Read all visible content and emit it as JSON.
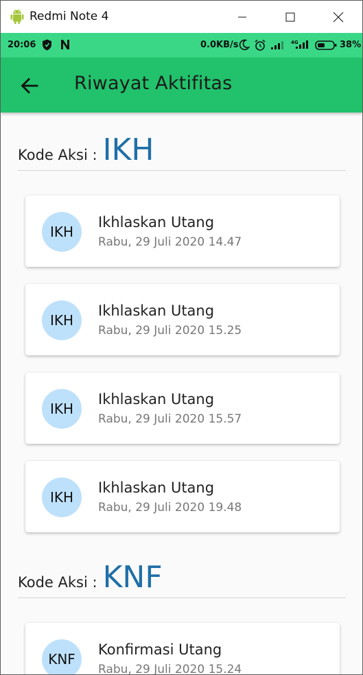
{
  "window": {
    "title": "Redmi Note 4",
    "icon": "android-icon",
    "buttons": [
      "minimize-icon",
      "maximize-icon",
      "close-icon"
    ]
  },
  "status_bar": {
    "time": "20:06",
    "speed": "0.0KB/s",
    "battery": "38%",
    "icons": [
      "shield-icon",
      "n-icon",
      "moon-icon",
      "alarm-icon",
      "signal-icon",
      "signal-icon",
      "battery-icon"
    ]
  },
  "app_bar": {
    "title": "Riwayat Aktifitas",
    "back_icon": "arrow-back-icon"
  },
  "colors": {
    "status_bar": "#3ad886",
    "app_bar": "#21c26b",
    "code": "#1f6fa8",
    "avatar": "#bee1fb"
  },
  "sections": [
    {
      "label": "Kode Aksi :",
      "code": "IKH",
      "items": [
        {
          "avatar": "IKH",
          "title": "Ikhlaskan Utang",
          "date": "Rabu, 29 Juli 2020 14.47"
        },
        {
          "avatar": "IKH",
          "title": "Ikhlaskan Utang",
          "date": "Rabu, 29 Juli 2020 15.25"
        },
        {
          "avatar": "IKH",
          "title": "Ikhlaskan Utang",
          "date": "Rabu, 29 Juli 2020 15.57"
        },
        {
          "avatar": "IKH",
          "title": "Ikhlaskan Utang",
          "date": "Rabu, 29 Juli 2020 19.48"
        }
      ]
    },
    {
      "label": "Kode Aksi :",
      "code": "KNF",
      "items": [
        {
          "avatar": "KNF",
          "title": "Konfirmasi Utang",
          "date": "Rabu, 29 Juli 2020 15.24"
        }
      ]
    }
  ]
}
